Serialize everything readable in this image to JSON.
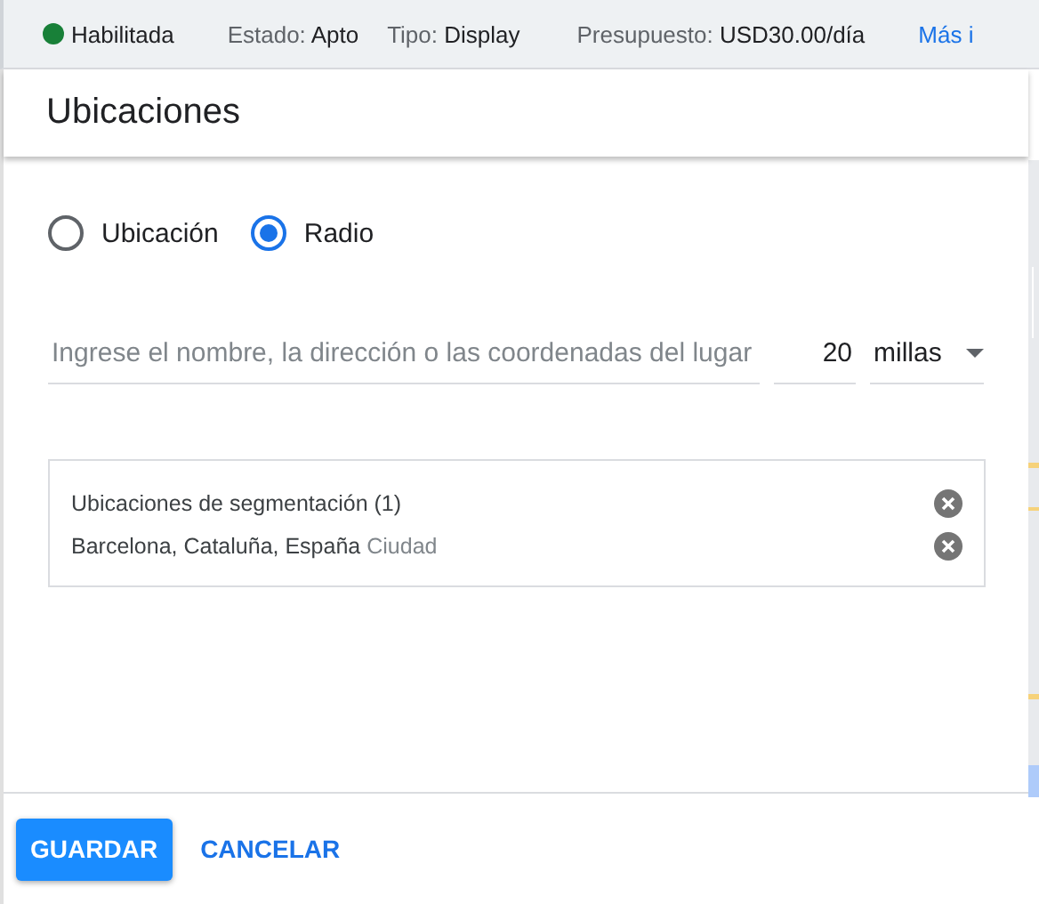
{
  "status_bar": {
    "status": {
      "label": "Habilitada",
      "color": "#188038"
    },
    "fields": [
      {
        "label": "Estado:",
        "value": "Apto"
      },
      {
        "label": "Tipo:",
        "value": "Display"
      },
      {
        "label": "Presupuesto:",
        "value": "USD30.00/día"
      }
    ],
    "link": "Más i"
  },
  "panel": {
    "title": "Ubicaciones",
    "options": [
      {
        "label": "Ubicación",
        "selected": false
      },
      {
        "label": "Radio",
        "selected": true
      }
    ],
    "search": {
      "placeholder": "Ingrese el nombre, la dirección o las coordenadas del lugar"
    },
    "radius": {
      "value": "20"
    },
    "unit": {
      "value": "millas"
    },
    "targets": {
      "title": "Ubicaciones de segmentación (1)",
      "items": [
        {
          "name": "Barcelona, Cataluña, España",
          "type": "Ciudad"
        }
      ]
    },
    "buttons": {
      "save": "GUARDAR",
      "cancel": "CANCELAR"
    }
  }
}
